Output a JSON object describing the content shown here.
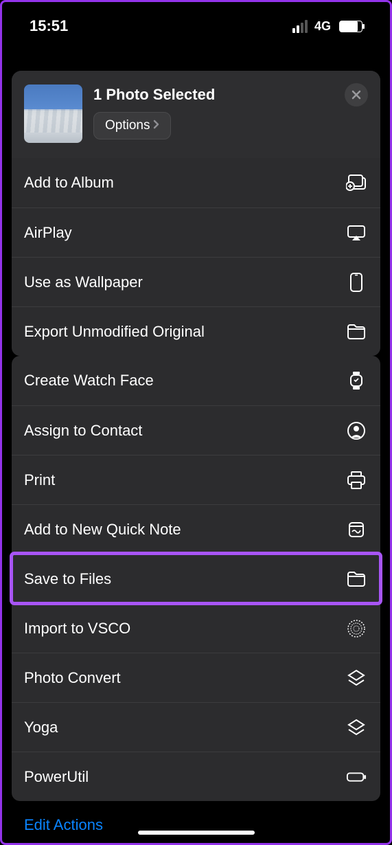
{
  "status": {
    "time": "15:51",
    "network": "4G"
  },
  "sheet": {
    "title": "1 Photo Selected",
    "options_label": "Options"
  },
  "group1": [
    {
      "label": "Add to Album",
      "icon": "album-add"
    },
    {
      "label": "AirPlay",
      "icon": "airplay"
    },
    {
      "label": "Use as Wallpaper",
      "icon": "phone"
    },
    {
      "label": "Export Unmodified Original",
      "icon": "folder"
    }
  ],
  "group2": [
    {
      "label": "Create Watch Face",
      "icon": "watch"
    },
    {
      "label": "Assign to Contact",
      "icon": "person-circle"
    },
    {
      "label": "Print",
      "icon": "printer"
    },
    {
      "label": "Add to New Quick Note",
      "icon": "note"
    },
    {
      "label": "Save to Files",
      "icon": "folder",
      "highlight": true
    },
    {
      "label": "Import to VSCO",
      "icon": "vsco"
    },
    {
      "label": "Photo Convert",
      "icon": "stack"
    },
    {
      "label": "Yoga",
      "icon": "stack"
    },
    {
      "label": "PowerUtil",
      "icon": "battery"
    }
  ],
  "footer": {
    "edit_label": "Edit Actions"
  }
}
